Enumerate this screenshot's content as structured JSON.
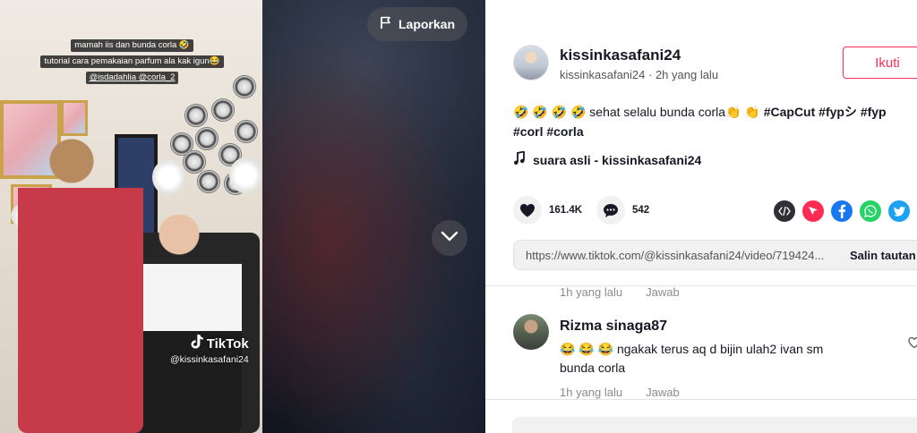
{
  "video": {
    "caption_lines": [
      "mamah iis dan bunda corla 🤣",
      "tutorial cara pemakaian parfum ala kak igun😂",
      "@isdadahlia @corla_2"
    ],
    "watermark_brand": "TikTok",
    "watermark_user": "@kissinkasafani24",
    "report_label": "Laporkan",
    "report_icon": "flag-icon",
    "next_icon": "chevron-down-icon"
  },
  "post": {
    "author_username": "kissinkasafani24",
    "author_meta": "kissinkasafani24 · 2h yang lalu",
    "follow_label": "Ikuti",
    "description_line1_plain": "🤣 🤣 🤣 🤣  sehat selalu bunda corla👏 👏 ",
    "description_line1_tags": "#CapCut #fypシ #fyp",
    "description_line2_tags": "#corl #corla",
    "music": "suara asli - kissinkasafani24",
    "likes": "161.4K",
    "comments": "542",
    "link": "https://www.tiktok.com/@kissinkasafani24/video/719424...",
    "copy_link_label": "Salin tautan",
    "share_icons": [
      "embed-icon",
      "send-icon",
      "facebook-icon",
      "whatsapp-icon",
      "twitter-icon"
    ],
    "colors": {
      "accent": "#fe2c55"
    }
  },
  "comments": {
    "prev_comment_time": "1h yang lalu",
    "reply_label": "Jawab",
    "items": [
      {
        "user": "Rizma sinaga87",
        "text": "😂 😂 😂  ngakak terus aq d bijin ulah2 ivan sm bunda corla",
        "time": "1h yang lalu",
        "reply": "Jawab"
      }
    ]
  }
}
